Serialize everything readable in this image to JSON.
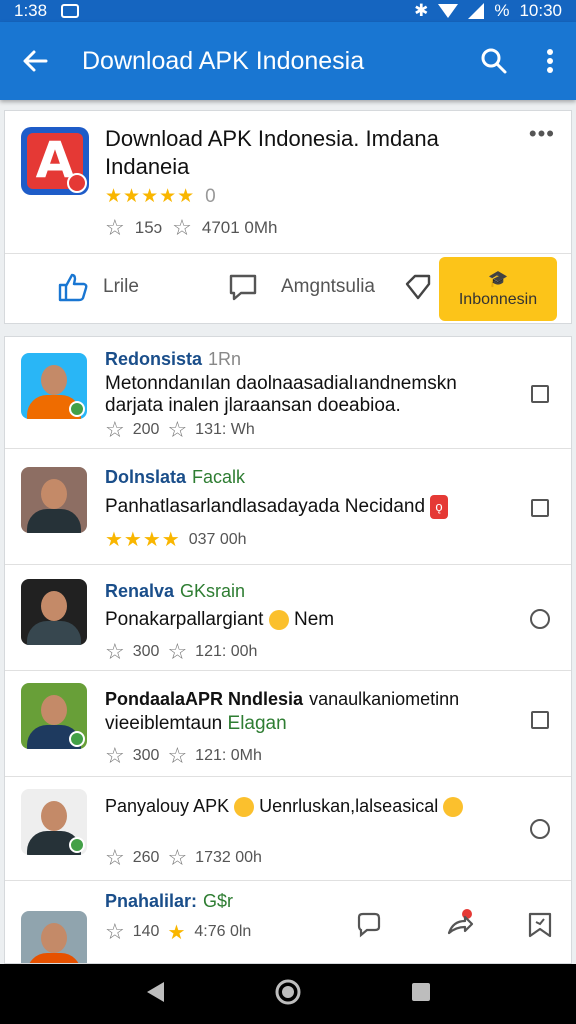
{
  "status_bar": {
    "time_left": "1:38",
    "battery": "%",
    "time_right": "10:30"
  },
  "app_bar": {
    "title": "Download APK Indonesia"
  },
  "app_card": {
    "logo_letter": "A",
    "title": "Download APK Indonesia. Imdana Indaneia",
    "stars": "★★★★★",
    "rating_count": "0",
    "stat1": "15ɔ",
    "stat2": "4701 0Mh",
    "like_label": "Lrile",
    "comment_label": "Amgntsulia",
    "install_label": "Inbonnesin",
    "more": "•••"
  },
  "list": [
    {
      "name": "Redonsista",
      "tag": "1Rn",
      "text": "Metonndanılan daolnaasadialıandnemskn darjata inalen jlaraansan doeabioa.",
      "stat1": "200",
      "stat2": "131: Wh",
      "control": "checkbox",
      "colors": {
        "bg": "#29b6f6",
        "body": "#ef6c00"
      }
    },
    {
      "name": "Dolnslata",
      "tag": "Facalk",
      "text": "Panhatlasarlandlasadayada Necidand",
      "stat_stars": "★★★★",
      "stat2": "037 00h",
      "control": "checkbox",
      "colors": {
        "bg": "#8d6e63",
        "body": "#263238"
      }
    },
    {
      "name": "Renalva",
      "tag": "GKsrain",
      "text": "Ponakarpallargiant",
      "text_tail": "Nem",
      "stat1": "300",
      "stat2": "121: 00h",
      "control": "radio",
      "colors": {
        "bg": "#212121",
        "body": "#37474f"
      }
    },
    {
      "name": "PondaalaAPR Nndlesia",
      "tag": "vanaulkaniometinn",
      "text": "vieeiblemtaun",
      "text_tail": "Elagan",
      "stat1": "300",
      "stat2": "121: 0Mh",
      "control": "checkbox",
      "colors": {
        "bg": "#689f38",
        "body": "#1e3a5f"
      }
    },
    {
      "name": "Panyalouy APK",
      "tag": "Uenrluskan,lalseasical",
      "text": "",
      "stat1": "260",
      "stat2": "1732 00h",
      "control": "radio",
      "colors": {
        "bg": "#eeeeee",
        "body": "#263238"
      }
    },
    {
      "name": "Pnahalilar:",
      "tag": "G$r",
      "text": "",
      "stat1": "140",
      "stat2": "4:76 0ln",
      "control": "actions",
      "colors": {
        "bg": "#90a4ae",
        "body": "#e65100"
      }
    }
  ],
  "nav": {
    "back": "back-icon",
    "home": "home-icon",
    "recents": "recents-icon"
  }
}
